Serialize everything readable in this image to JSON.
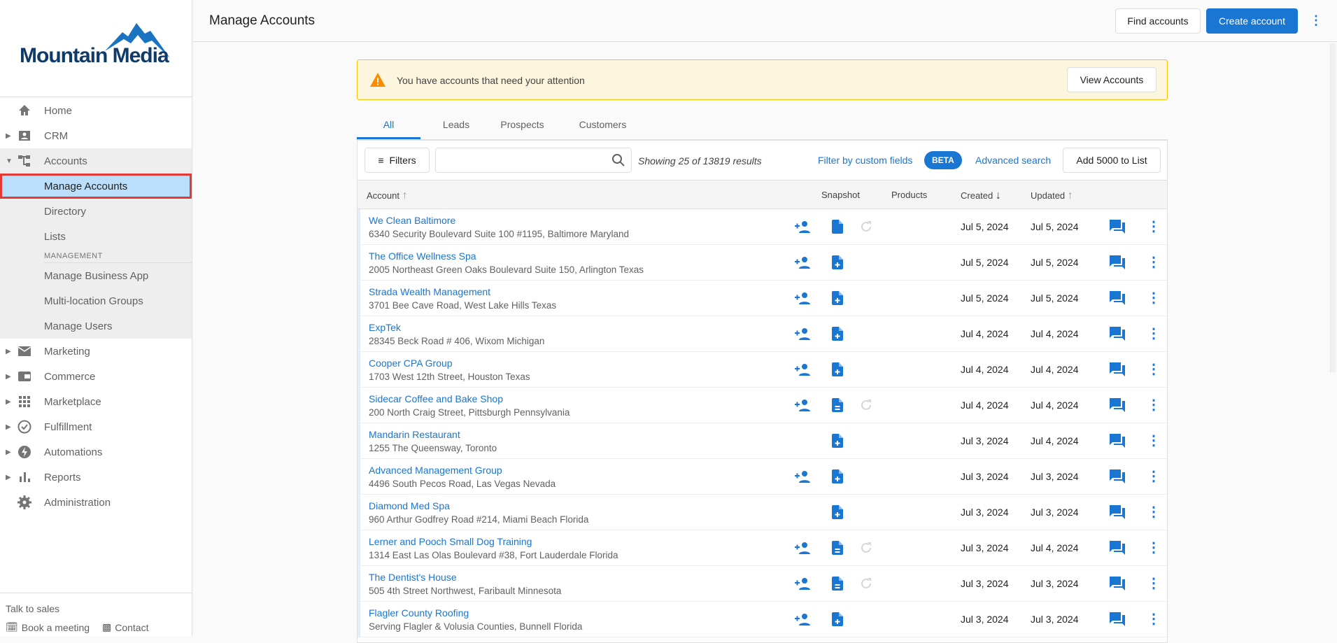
{
  "brand": {
    "name": "Mountain Media",
    "color": "#1976d2"
  },
  "sidebar": {
    "items": [
      {
        "label": "Home",
        "icon": "home-icon"
      },
      {
        "label": "CRM",
        "icon": "contact-card-icon"
      },
      {
        "label": "Accounts",
        "icon": "account-tree-icon"
      },
      {
        "label": "Marketing",
        "icon": "mail-icon"
      },
      {
        "label": "Commerce",
        "icon": "wallet-icon"
      },
      {
        "label": "Marketplace",
        "icon": "apps-grid-icon"
      },
      {
        "label": "Fulfillment",
        "icon": "check-circle-icon"
      },
      {
        "label": "Automations",
        "icon": "bolt-icon"
      },
      {
        "label": "Reports",
        "icon": "bar-chart-icon"
      },
      {
        "label": "Administration",
        "icon": "gear-icon"
      }
    ],
    "accounts_sub": [
      "Manage Accounts",
      "Directory",
      "Lists"
    ],
    "management_label": "MANAGEMENT",
    "management_sub": [
      "Manage Business App",
      "Multi-location Groups",
      "Manage Users"
    ],
    "talk_to_sales": "Talk to sales",
    "book_meeting": "Book a meeting",
    "contact": "Contact"
  },
  "header": {
    "title": "Manage Accounts",
    "find": "Find accounts",
    "create": "Create account"
  },
  "alert": {
    "message": "You have accounts that need your attention",
    "button": "View Accounts"
  },
  "tabs": [
    "All",
    "Leads",
    "Prospects",
    "Customers"
  ],
  "toolbar": {
    "filters": "Filters",
    "search_placeholder": "",
    "showing": "Showing 25 of 13819 results",
    "custom_fields": "Filter by custom fields",
    "beta": "BETA",
    "advanced": "Advanced search",
    "add_list": "Add 5000 to List"
  },
  "columns": {
    "account": "Account",
    "snapshot": "Snapshot",
    "products": "Products",
    "created": "Created",
    "updated": "Updated"
  },
  "rows": [
    {
      "name": "We Clean Baltimore",
      "address": "6340 Security Boulevard Suite 100 #1195, Baltimore Maryland",
      "created": "Jul 5, 2024",
      "updated": "Jul 5, 2024",
      "person": true,
      "doc": "file",
      "refresh": true
    },
    {
      "name": "The Office Wellness Spa",
      "address": "2005 Northeast Green Oaks Boulevard Suite 150, Arlington Texas",
      "created": "Jul 5, 2024",
      "updated": "Jul 5, 2024",
      "person": true,
      "doc": "add",
      "refresh": false
    },
    {
      "name": "Strada Wealth Management",
      "address": "3701 Bee Cave Road, West Lake Hills Texas",
      "created": "Jul 5, 2024",
      "updated": "Jul 5, 2024",
      "person": true,
      "doc": "add",
      "refresh": false
    },
    {
      "name": "ExpTek",
      "address": "28345 Beck Road # 406, Wixom Michigan",
      "created": "Jul 4, 2024",
      "updated": "Jul 4, 2024",
      "person": true,
      "doc": "add",
      "refresh": false
    },
    {
      "name": "Cooper CPA Group",
      "address": "1703 West 12th Street, Houston Texas",
      "created": "Jul 4, 2024",
      "updated": "Jul 4, 2024",
      "person": true,
      "doc": "add",
      "refresh": false
    },
    {
      "name": "Sidecar Coffee and Bake Shop",
      "address": "200 North Craig Street, Pittsburgh Pennsylvania",
      "created": "Jul 4, 2024",
      "updated": "Jul 4, 2024",
      "person": true,
      "doc": "lines",
      "refresh": true
    },
    {
      "name": "Mandarin Restaurant",
      "address": "1255 The Queensway, Toronto",
      "created": "Jul 3, 2024",
      "updated": "Jul 4, 2024",
      "person": false,
      "doc": "add",
      "refresh": false
    },
    {
      "name": "Advanced Management Group",
      "address": "4496 South Pecos Road, Las Vegas Nevada",
      "created": "Jul 3, 2024",
      "updated": "Jul 3, 2024",
      "person": true,
      "doc": "add",
      "refresh": false
    },
    {
      "name": "Diamond Med Spa",
      "address": "960 Arthur Godfrey Road #214, Miami Beach Florida",
      "created": "Jul 3, 2024",
      "updated": "Jul 3, 2024",
      "person": false,
      "doc": "add",
      "refresh": false
    },
    {
      "name": "Lerner and Pooch Small Dog Training",
      "address": "1314 East Las Olas Boulevard #38, Fort Lauderdale Florida",
      "created": "Jul 3, 2024",
      "updated": "Jul 4, 2024",
      "person": true,
      "doc": "lines",
      "refresh": true
    },
    {
      "name": "The Dentist's House",
      "address": "505 4th Street Northwest, Faribault Minnesota",
      "created": "Jul 3, 2024",
      "updated": "Jul 3, 2024",
      "person": true,
      "doc": "lines",
      "refresh": true
    },
    {
      "name": "Flagler County Roofing",
      "address": "Serving Flagler & Volusia Counties, Bunnell Florida",
      "created": "Jul 3, 2024",
      "updated": "Jul 3, 2024",
      "person": true,
      "doc": "add",
      "refresh": false
    }
  ]
}
